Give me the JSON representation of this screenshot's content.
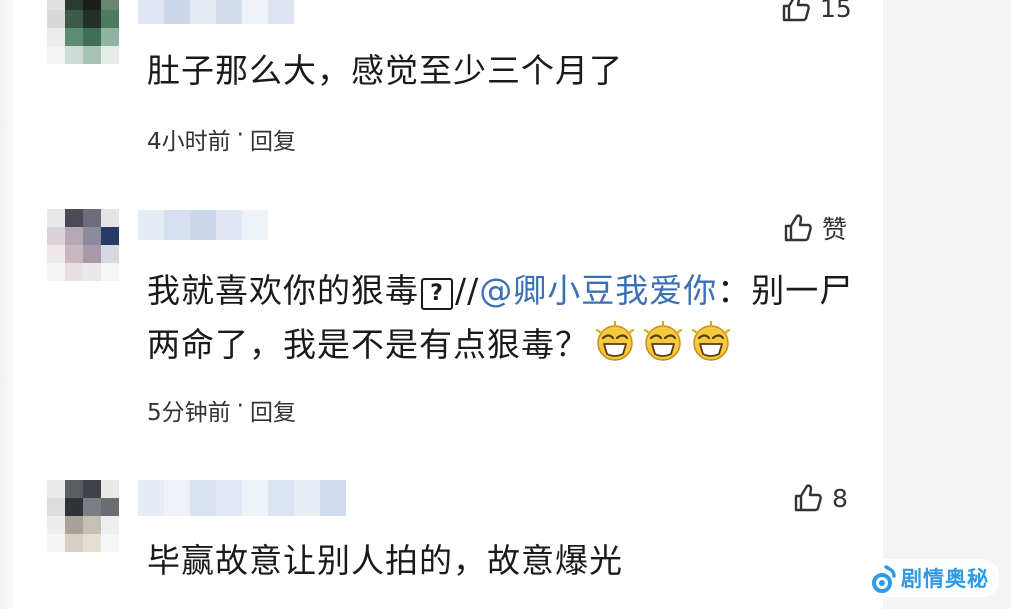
{
  "comments": [
    {
      "text": "肚子那么大，感觉至少三个月了",
      "time": "4小时前",
      "separator": "·",
      "reply": "回复",
      "like_count": "15"
    },
    {
      "text_before": "我就喜欢你的狠毒",
      "unknown_glyph": "?",
      "slashes": "//",
      "mention": "@卿小豆我爱你",
      "text_after": "：别一尸两命了，我是不是有点狠毒？",
      "time": "5分钟前",
      "separator": "·",
      "reply": "回复",
      "like_label": "赞",
      "emoji_icons": [
        "laughing-face-icon",
        "laughing-face-icon",
        "laughing-face-icon"
      ]
    },
    {
      "text": "毕赢故意让别人拍的，故意爆光",
      "like_count": "8"
    }
  ],
  "watermark": {
    "text": "剧情奥秘",
    "color": "#2f9be6"
  },
  "colors": {
    "mention": "#3c6fb4",
    "text": "#1a1a1a",
    "meta": "#333333"
  }
}
